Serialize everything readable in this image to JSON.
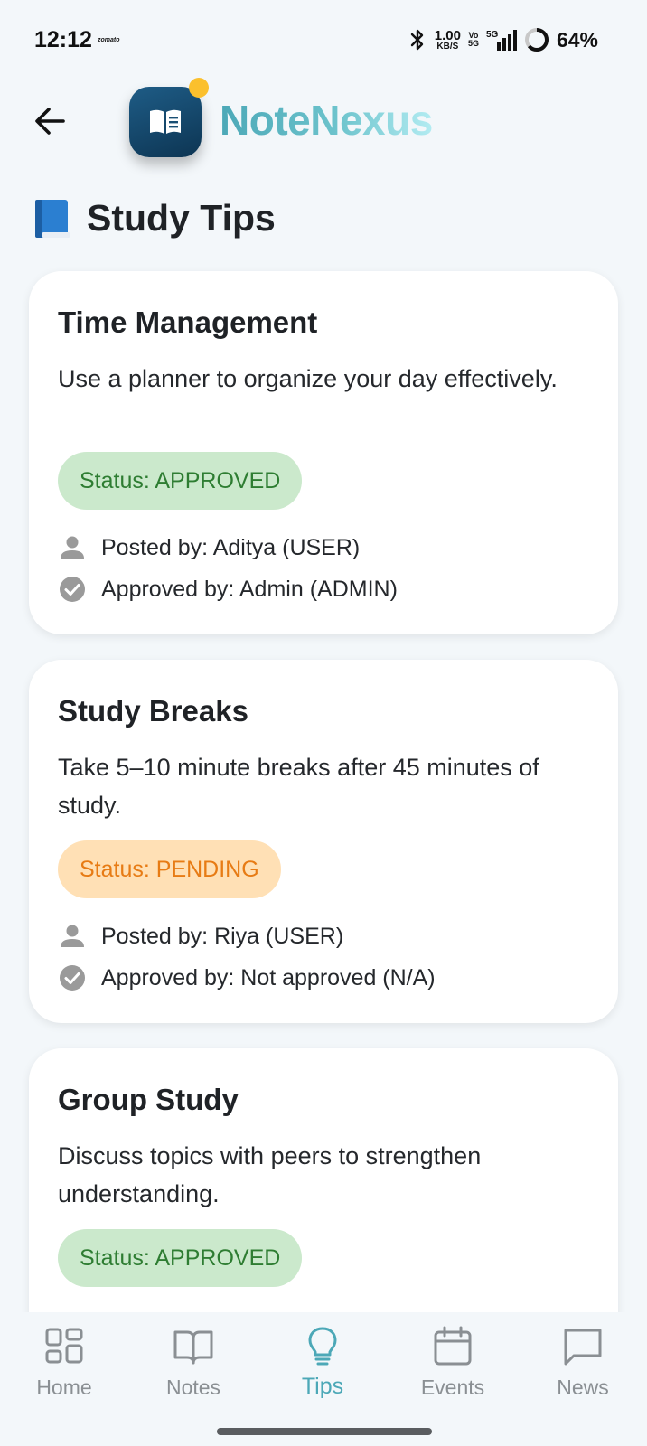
{
  "status_bar": {
    "time": "12:12",
    "notification_app": "zomato",
    "net_speed_value": "1.00",
    "net_speed_unit": "KB/S",
    "volte_top": "Vo",
    "volte_bottom": "5G",
    "signal_label": "5G",
    "battery": "64%"
  },
  "header": {
    "brand": "NoteNexus",
    "icons": {
      "back": "arrow-left-icon",
      "logo": "book-icon"
    }
  },
  "page": {
    "title_emoji": "📘",
    "title": "Study Tips"
  },
  "tips": [
    {
      "title": "Time Management",
      "description": "Use a planner to organize your day effectively.",
      "status": "Status: APPROVED",
      "status_kind": "approved",
      "posted_by": "Posted by: Aditya (USER)",
      "approved_by": "Approved by: Admin (ADMIN)"
    },
    {
      "title": "Study Breaks",
      "description": "Take 5–10 minute breaks after 45 minutes of study.",
      "status": "Status: PENDING",
      "status_kind": "pending",
      "posted_by": "Posted by: Riya (USER)",
      "approved_by": "Approved by: Not approved (N/A)"
    },
    {
      "title": "Group Study",
      "description": "Discuss topics with peers to strengthen understanding.",
      "status": "Status: APPROVED",
      "status_kind": "approved"
    }
  ],
  "nav": {
    "items": [
      {
        "label": "Home",
        "icon": "grid-icon"
      },
      {
        "label": "Notes",
        "icon": "book-open-icon"
      },
      {
        "label": "Tips",
        "icon": "lightbulb-icon",
        "active": true
      },
      {
        "label": "Events",
        "icon": "calendar-icon"
      },
      {
        "label": "News",
        "icon": "chat-bubble-icon"
      }
    ]
  },
  "colors": {
    "accent": "#4ca8b7",
    "approved_bg": "#cbe9cc",
    "approved_text": "#2e7d32",
    "pending_bg": "#ffe0b5",
    "pending_text": "#e77b14",
    "logo_dot": "#fbc02d"
  }
}
